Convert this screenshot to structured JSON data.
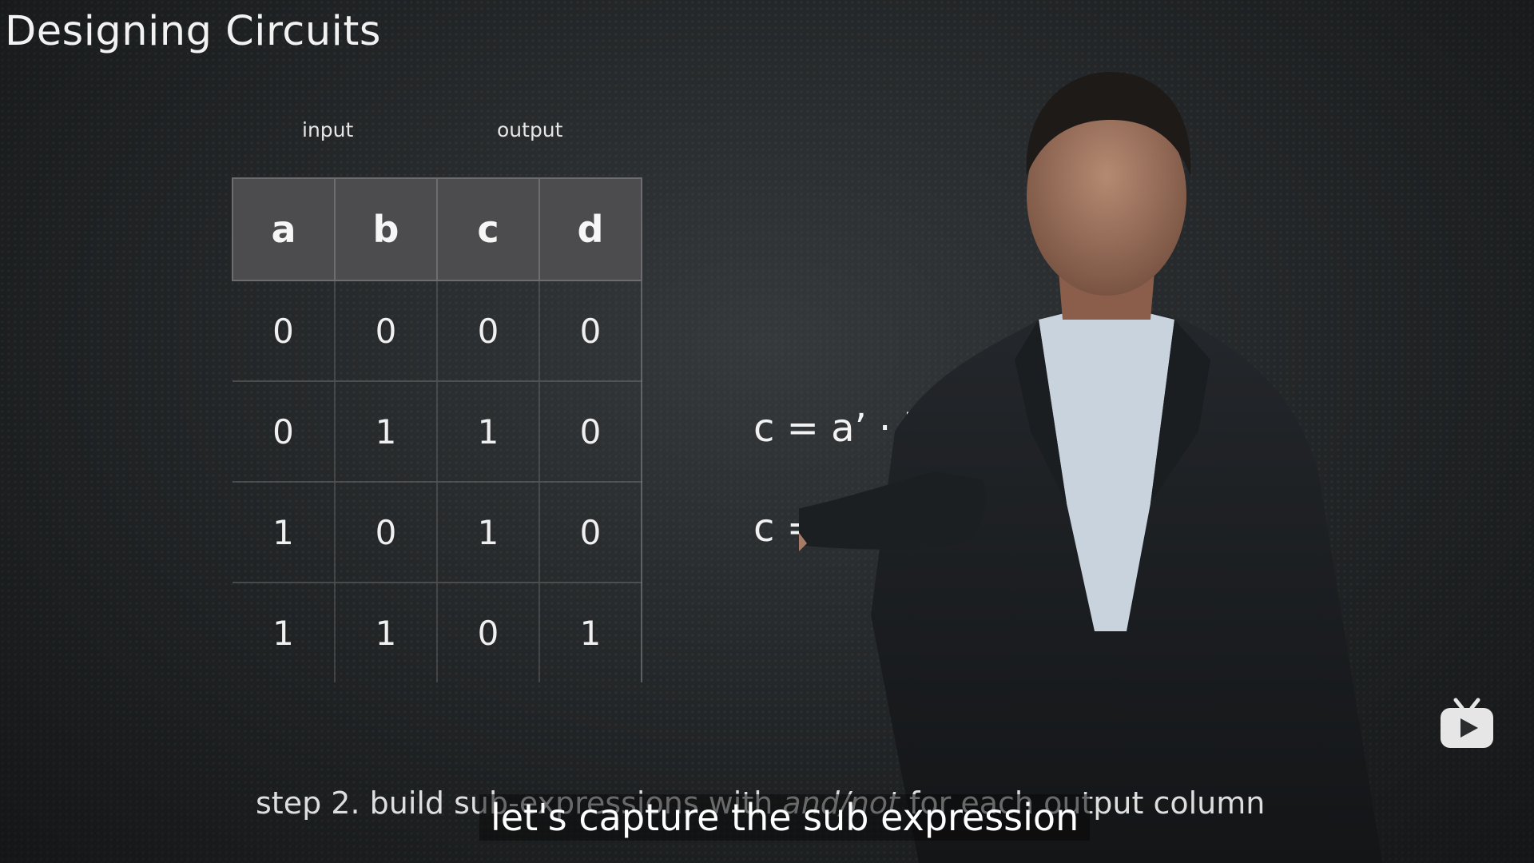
{
  "slide": {
    "title": "Designing Circuits",
    "input_label": "input",
    "output_label": "output"
  },
  "truth_table": {
    "headers": [
      "a",
      "b",
      "c",
      "d"
    ],
    "rows": [
      [
        "0",
        "0",
        "0",
        "0"
      ],
      [
        "0",
        "1",
        "1",
        "0"
      ],
      [
        "1",
        "0",
        "1",
        "0"
      ],
      [
        "1",
        "1",
        "0",
        "1"
      ]
    ]
  },
  "equations": [
    "c = a’ · b",
    "c = a · b’"
  ],
  "step_caption": {
    "before": "step 2. build sub-expressions with ",
    "italic": "and/not",
    "after": " for each output column"
  },
  "subtitle": "let's capture the sub expression",
  "icons": {
    "player_logo": "tv-play-icon"
  },
  "colors": {
    "background": "#222527",
    "table_header": "#4c4c4e"
  }
}
